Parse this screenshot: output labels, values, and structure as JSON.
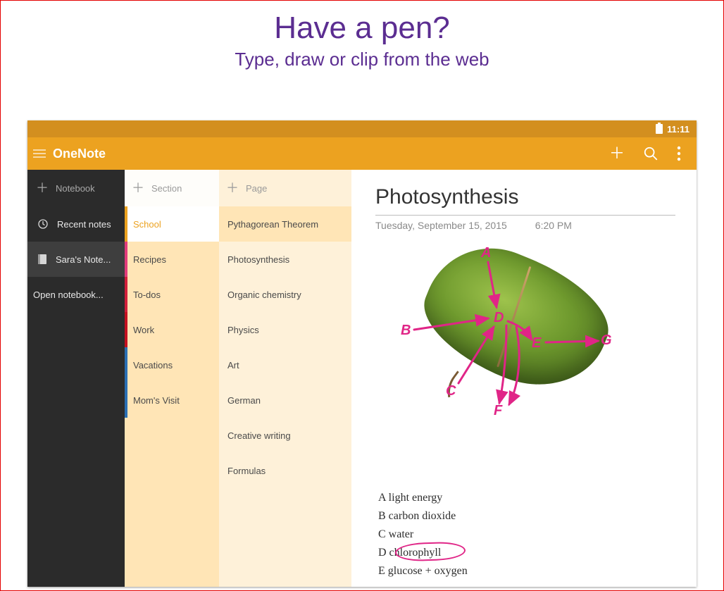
{
  "promo": {
    "title": "Have a pen?",
    "subtitle": "Type, draw or clip from the web"
  },
  "statusbar": {
    "time": "11:11"
  },
  "appbar": {
    "title": "OneNote"
  },
  "sidebar": {
    "add_label": "Notebook",
    "recent_label": "Recent notes",
    "notebook_label": "Sara's Note...",
    "open_label": "Open notebook..."
  },
  "sections": {
    "add_label": "Section",
    "items": [
      {
        "label": "School",
        "color": "#eca220",
        "active": true
      },
      {
        "label": "Recipes",
        "color": "#e23b7a"
      },
      {
        "label": "To-dos",
        "color": "#d11f3a"
      },
      {
        "label": "Work",
        "color": "#c41020"
      },
      {
        "label": "Vacations",
        "color": "#2a6fb3"
      },
      {
        "label": "Mom's Visit",
        "color": "#2a6fb3"
      }
    ]
  },
  "pages": {
    "add_label": "Page",
    "items": [
      {
        "label": "Pythagorean Theorem",
        "active": true
      },
      {
        "label": "Photosynthesis"
      },
      {
        "label": "Organic chemistry"
      },
      {
        "label": "Physics"
      },
      {
        "label": "Art"
      },
      {
        "label": "German"
      },
      {
        "label": "Creative writing"
      },
      {
        "label": "Formulas"
      }
    ]
  },
  "note": {
    "title": "Photosynthesis",
    "date": "Tuesday, September 15, 2015",
    "time": "6:20 PM",
    "ink_labels": {
      "A": "A",
      "B": "B",
      "C": "C",
      "D": "D",
      "E": "E",
      "F": "F",
      "G": "G"
    },
    "legend": {
      "A": "A   light energy",
      "B": "B   carbon dioxide",
      "C": "C   water",
      "D": "D   chlorophyll",
      "E": "E   glucose + oxygen"
    }
  }
}
